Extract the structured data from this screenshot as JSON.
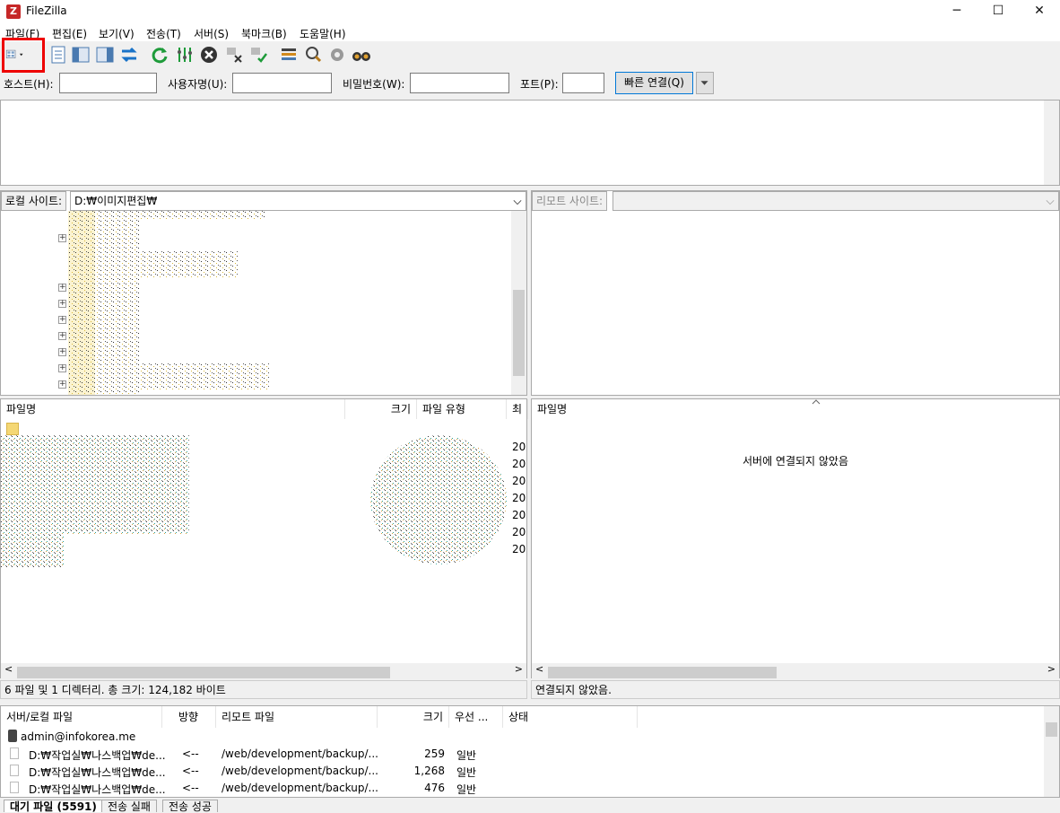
{
  "window": {
    "title": "FileZilla",
    "app_icon": "filezilla-icon"
  },
  "menu": [
    "파일(F)",
    "편집(E)",
    "보기(V)",
    "전송(T)",
    "서버(S)",
    "북마크(B)",
    "도움말(H)"
  ],
  "toolbar": [
    "site-manager-icon",
    "toggle-log-icon",
    "toggle-local-tree-icon",
    "toggle-remote-tree-icon",
    "toggle-queue-icon",
    "refresh-icon",
    "process-queue-icon",
    "cancel-icon",
    "disconnect-icon",
    "reconnect-icon",
    "filter-icon",
    "search-icon",
    "compare-icon",
    "find-files-icon"
  ],
  "quickconnect": {
    "host_label": "호스트(H):",
    "host_value": "",
    "user_label": "사용자명(U):",
    "user_value": "",
    "pass_label": "비밀번호(W):",
    "pass_value": "",
    "port_label": "포트(P):",
    "port_value": "",
    "connect_button": "빠른 연결(Q)"
  },
  "local": {
    "site_label": "로컬 사이트:",
    "path": "D:₩이미지편집₩",
    "columns": [
      "파일명",
      "크기",
      "파일 유형",
      "최"
    ],
    "dates": [
      "20",
      "20",
      "20",
      "20",
      "20",
      "20",
      "20"
    ],
    "status": "6 파일 및 1 디렉터리. 총 크기: 124,182 바이트"
  },
  "remote": {
    "site_label": "리모트 사이트:",
    "path": "",
    "columns": [
      "파일명"
    ],
    "not_connected_message": "서버에 연결되지 않았음",
    "status": "연결되지 않았음."
  },
  "queue": {
    "columns": [
      "서버/로컬 파일",
      "방향",
      "리모트 파일",
      "크기",
      "우선 ...",
      "상태"
    ],
    "server": "admin@infokorea.me",
    "rows": [
      {
        "local": "D:₩작업실₩나스백업₩de...",
        "dir": "<--",
        "remote": "/web/development/backup/...",
        "size": "259",
        "priority": "일반"
      },
      {
        "local": "D:₩작업실₩나스백업₩de...",
        "dir": "<--",
        "remote": "/web/development/backup/...",
        "size": "1,268",
        "priority": "일반"
      },
      {
        "local": "D:₩작업실₩나스백업₩de...",
        "dir": "<--",
        "remote": "/web/development/backup/...",
        "size": "476",
        "priority": "일반"
      }
    ]
  },
  "tabs": [
    "대기 파일 (5591)",
    "전송 실패",
    "전송 성공"
  ]
}
